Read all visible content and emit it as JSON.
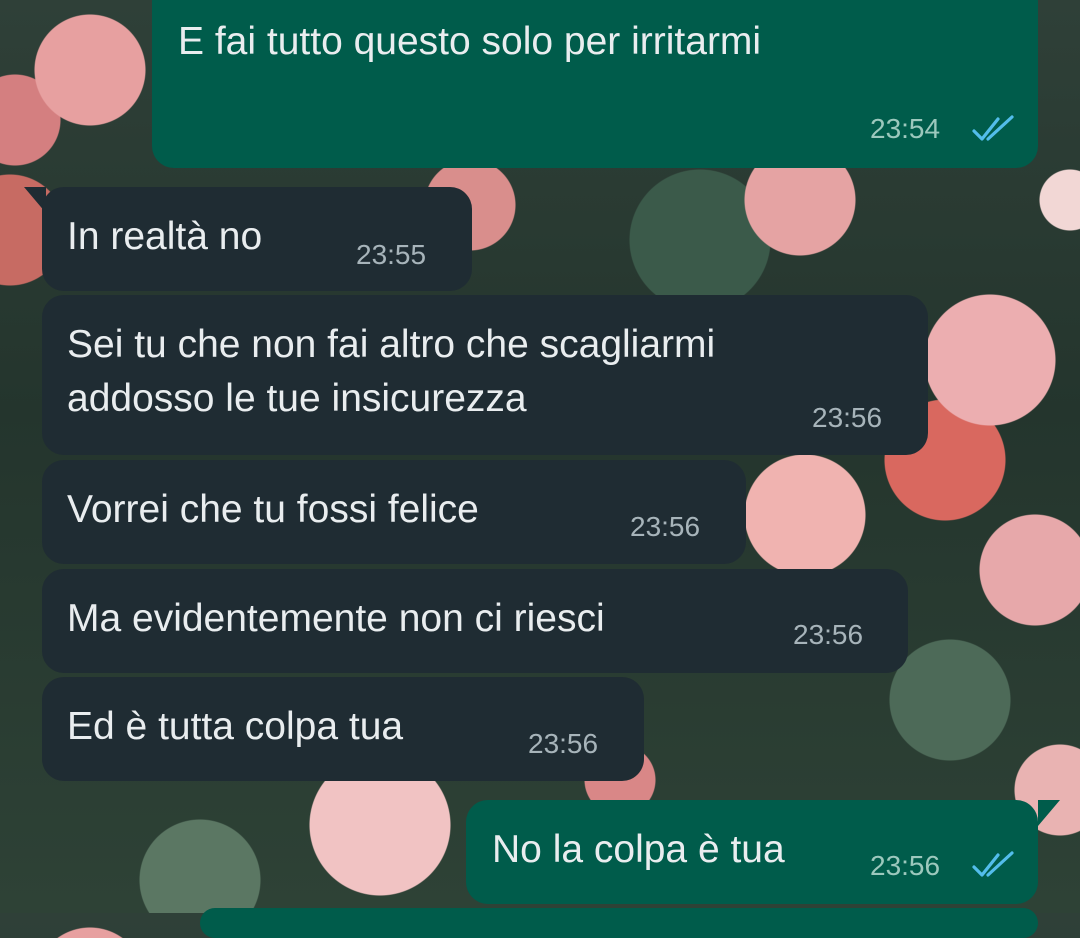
{
  "messages": [
    {
      "dir": "out",
      "text": "E fai tutto questo solo per irritarmi",
      "time": "23:54",
      "status": "read"
    },
    {
      "dir": "in",
      "text": "In realtà no",
      "time": "23:55"
    },
    {
      "dir": "in",
      "text_lines": [
        "Sei tu che non fai altro che scagliarmi",
        "addosso le tue insicurezza"
      ],
      "time": "23:56"
    },
    {
      "dir": "in",
      "text": "Vorrei che tu fossi felice",
      "time": "23:56"
    },
    {
      "dir": "in",
      "text": "Ma evidentemente non ci riesci",
      "time": "23:56"
    },
    {
      "dir": "in",
      "text": "Ed è tutta colpa tua",
      "time": "23:56"
    },
    {
      "dir": "out",
      "text": "No la colpa è tua",
      "time": "23:56",
      "status": "read"
    }
  ],
  "icons": {
    "read_receipt": "double-check-icon"
  },
  "colors": {
    "incoming_bubble": "#1f2c33",
    "outgoing_bubble": "#005c4b",
    "text": "#e9edef",
    "read_ticks": "#53bdeb"
  }
}
